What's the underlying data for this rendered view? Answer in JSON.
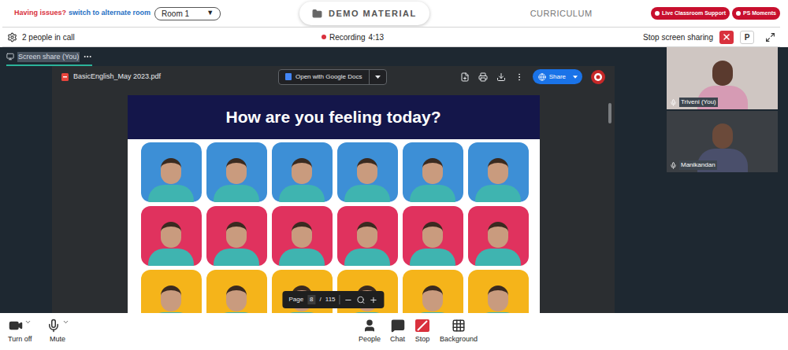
{
  "top_bar": {
    "issue_text": "Having issues?",
    "switch_link": "switch to alternate room",
    "room_select": {
      "value": "Room 1",
      "arrow": "▼"
    },
    "tabs": [
      {
        "label": "DEMO MATERIAL",
        "selected": true
      },
      {
        "label": "CURRICULUM",
        "selected": false
      }
    ],
    "buttons": [
      "Live Classroom Support",
      "PS Moments"
    ]
  },
  "call_bar": {
    "people": "2 people in call",
    "recording": {
      "label": "Recording",
      "time": "4:13",
      "active": true
    },
    "stop_sharing": "Stop screen sharing",
    "presenter_badge": "P"
  },
  "screen_share": {
    "label": "Screen share (You)",
    "selected": true
  },
  "pdf_viewer": {
    "file_name": "BasicEnglish_May 2023.pdf",
    "open_with": "Open with Google Docs",
    "share": "Share",
    "page": {
      "title": "How are you feeling today?",
      "photo_rows": [
        {
          "color": "#3d8fd6"
        },
        {
          "color": "#e0325e"
        },
        {
          "color": "#f5b41a"
        }
      ]
    },
    "pager": {
      "label": "Page",
      "current": "8",
      "separator": "/",
      "total": "115"
    }
  },
  "participants": [
    {
      "name": "Triveni (You)"
    },
    {
      "name": "Manikandan"
    }
  ],
  "media_controls": [
    {
      "label": "Turn off",
      "kind": "camera"
    },
    {
      "label": "Mute",
      "kind": "mic"
    }
  ],
  "call_controls": [
    {
      "label": "People",
      "kind": "people"
    },
    {
      "label": "Chat",
      "kind": "chat"
    },
    {
      "label": "Stop",
      "kind": "stop"
    },
    {
      "label": "Background",
      "kind": "background"
    }
  ]
}
